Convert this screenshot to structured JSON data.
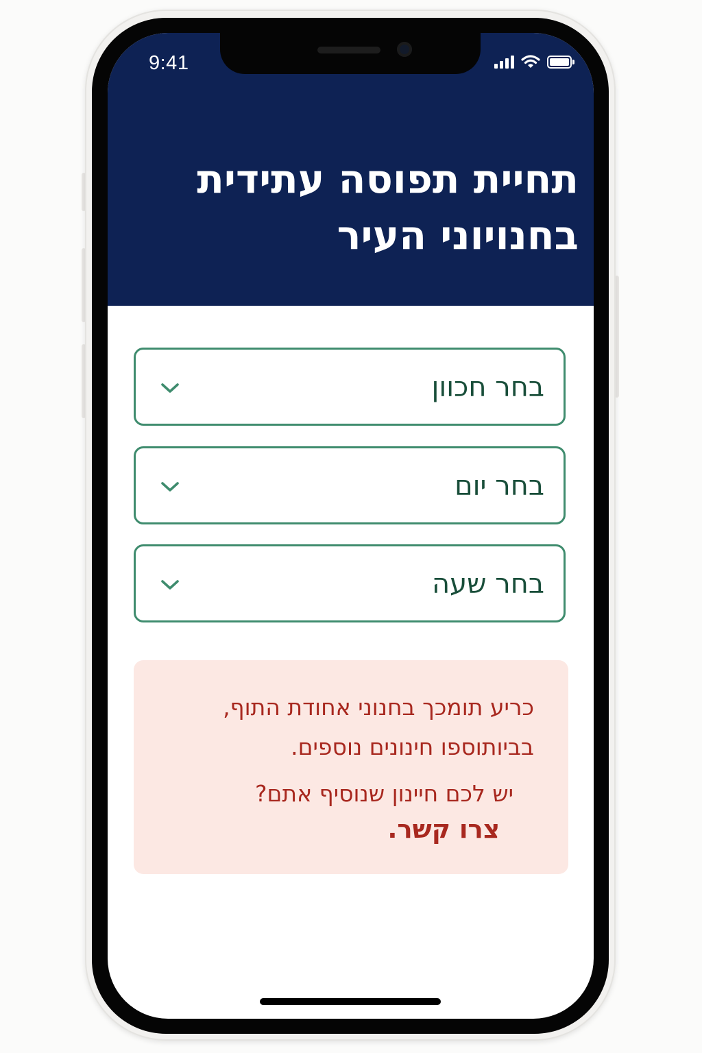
{
  "status_bar": {
    "time": "9:41",
    "signal_icon": "cellular-signal-icon",
    "wifi_icon": "wifi-icon",
    "battery_icon": "battery-icon",
    "battery_level": 1.0
  },
  "header": {
    "title": "תחיית תפוסה עתידית בחנויוני העיר",
    "background_color": "#0e2254"
  },
  "selects": [
    {
      "label": "בחר חכוון",
      "icon": "chevron-down-icon"
    },
    {
      "label": "בחר יום",
      "icon": "chevron-down-icon"
    },
    {
      "label": "בחר שעה",
      "icon": "chevron-down-icon"
    }
  ],
  "notice": {
    "text": "כריע תומכך בחנוני אחודת התוף, בביותוספו חינונים נוספים.",
    "question": "יש לכם חיינון שנוסיף אתם?",
    "cta": "צרו קשר.",
    "background_color": "#fce8e3",
    "text_color": "#a8281f"
  },
  "colors": {
    "accent_border": "#3f8c6e",
    "select_text": "#194e3a"
  }
}
